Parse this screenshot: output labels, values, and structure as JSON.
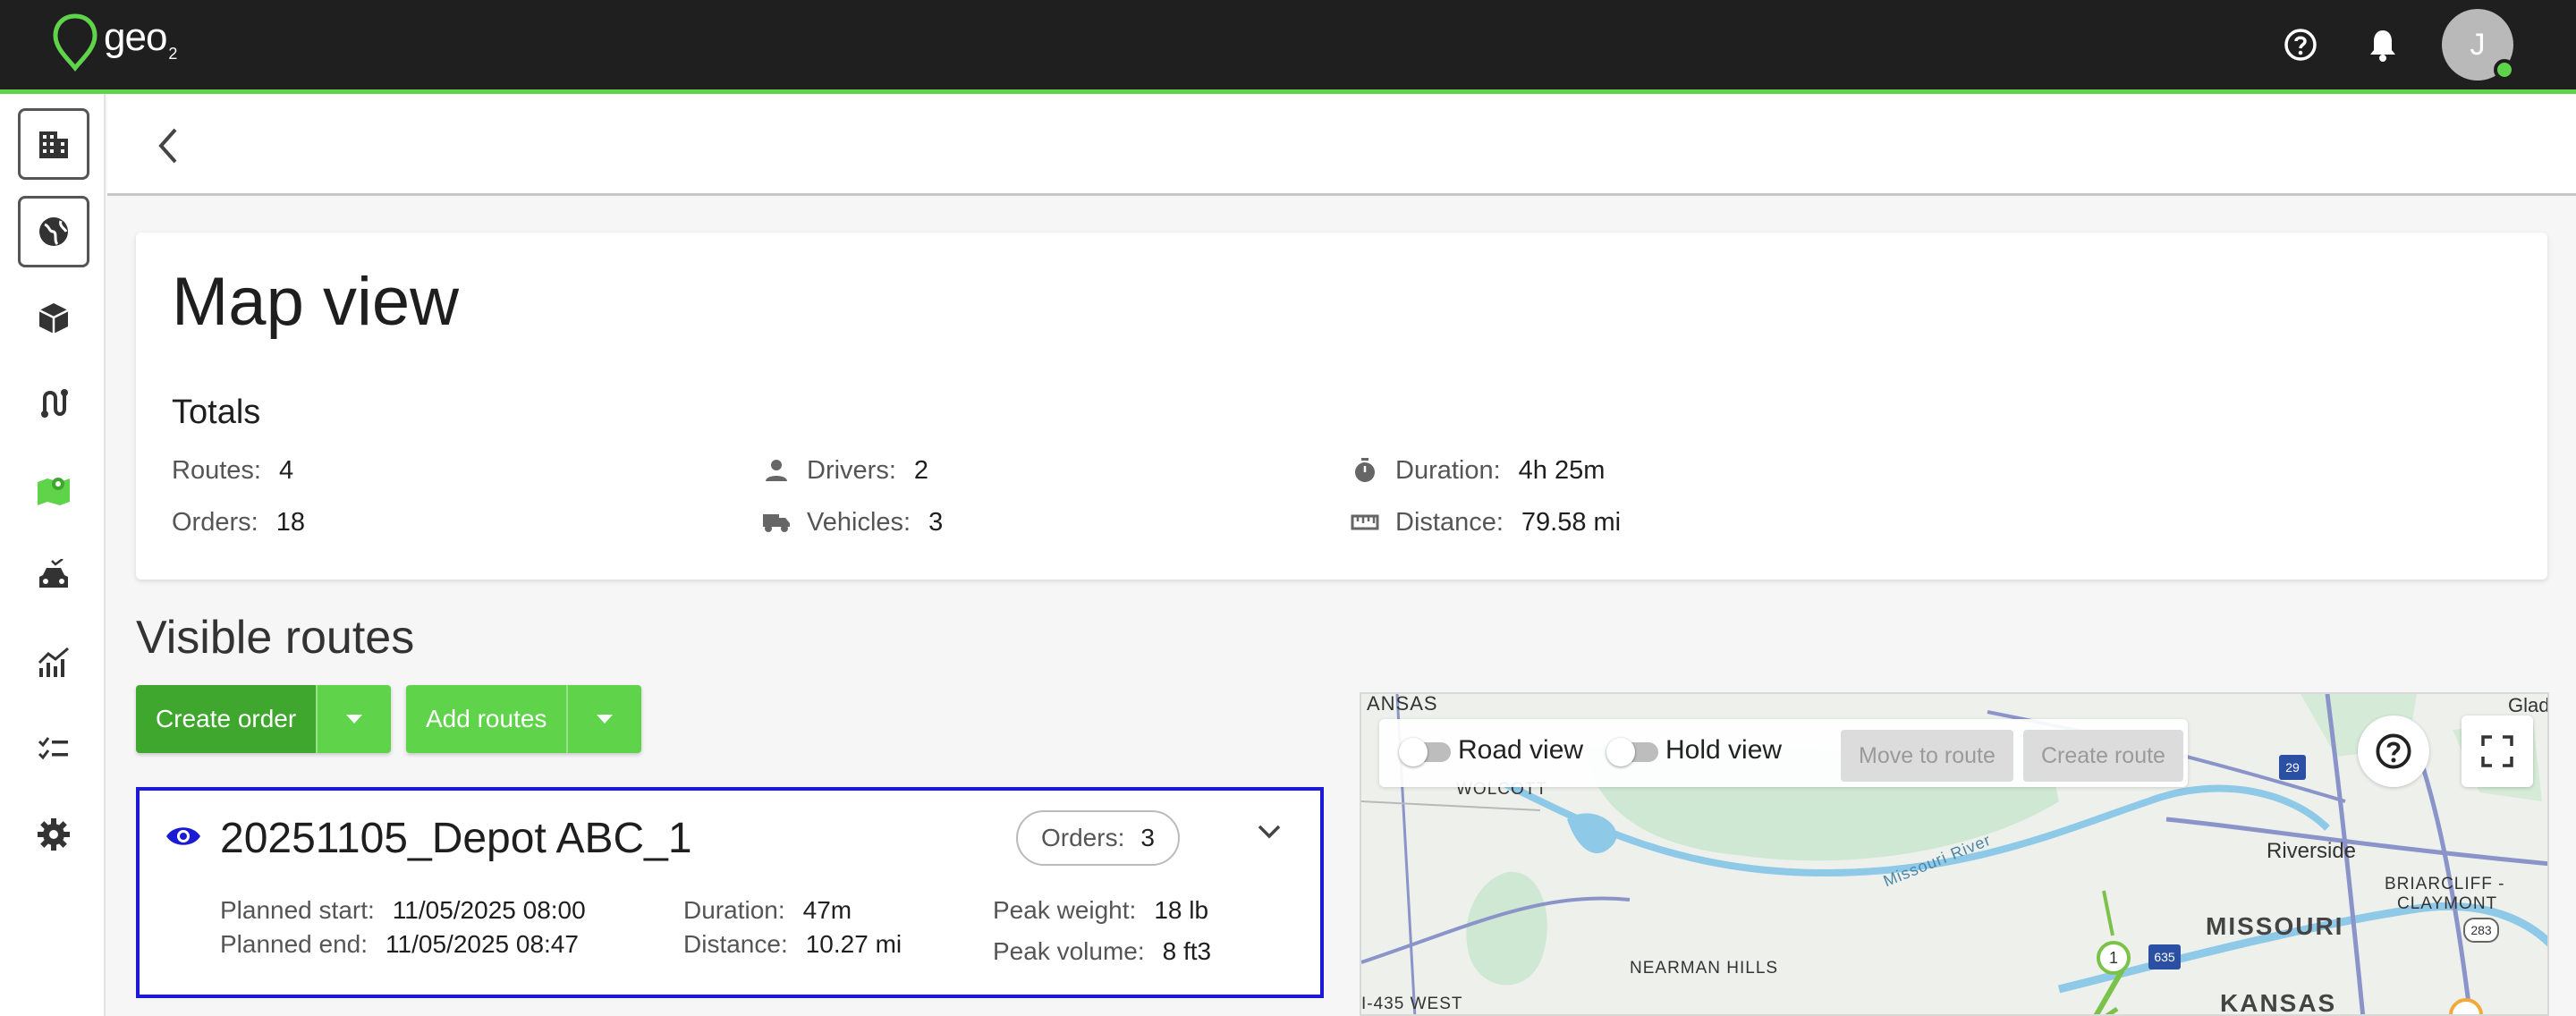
{
  "app": {
    "logo_text": "geo",
    "logo_sub": "2",
    "avatar_initial": "J"
  },
  "colors": {
    "brand_green": "#5fd34a",
    "dark_green": "#3fa72e",
    "route_border": "#1b1bd6",
    "topbar": "#1f1f1f"
  },
  "topbar": {
    "icons": [
      "help-icon",
      "bell-icon"
    ]
  },
  "sidebar": {
    "items": [
      {
        "icon": "building-icon"
      },
      {
        "icon": "globe-icon"
      },
      {
        "icon": "boxes-icon"
      },
      {
        "icon": "route-icon"
      },
      {
        "icon": "map-icon",
        "active": true
      },
      {
        "icon": "car-icon"
      },
      {
        "icon": "chart-icon"
      },
      {
        "icon": "checklist-icon"
      },
      {
        "icon": "gear-icon"
      }
    ]
  },
  "page": {
    "title": "Map view",
    "totals_heading": "Totals",
    "totals": {
      "routes_label": "Routes:",
      "routes": "4",
      "orders_label": "Orders:",
      "orders": "18",
      "drivers_label": "Drivers:",
      "drivers": "2",
      "vehicles_label": "Vehicles:",
      "vehicles": "3",
      "duration_label": "Duration:",
      "duration": "4h 25m",
      "distance_label": "Distance:",
      "distance": "79.58 mi"
    },
    "visible_routes_title": "Visible routes",
    "create_order_label": "Create order",
    "add_routes_label": "Add routes"
  },
  "route": {
    "name": "20251105_Depot ABC_1",
    "orders_label": "Orders:",
    "orders": "3",
    "planned_start_label": "Planned start:",
    "planned_start": "11/05/2025 08:00",
    "planned_end_label": "Planned end:",
    "planned_end": "11/05/2025 08:47",
    "duration_label": "Duration:",
    "duration": "47m",
    "distance_label": "Distance:",
    "distance": "10.27 mi",
    "peak_weight_label": "Peak weight:",
    "peak_weight": "18 lb",
    "peak_volume_label": "Peak volume:",
    "peak_volume": "8 ft3"
  },
  "map": {
    "road_view_label": "Road view",
    "hold_view_label": "Hold view",
    "move_to_route_label": "Move to route",
    "create_route_label": "Create route",
    "labels": {
      "kansas_top": "ANSAS",
      "wolcott": "WOLCOTT",
      "missouri_river": "Missouri River",
      "riverside": "Riverside",
      "briarcliff": "BRIARCLIFF -",
      "claymont": "CLAYMONT",
      "missouri": "MISSOURI",
      "nearman": "NEARMAN HILLS",
      "i435": "I-435 WEST",
      "kansas_bottom": "KANSAS",
      "glad": "Glad",
      "shield_29": "29",
      "shield_635": "635",
      "shield_283": "283",
      "stop_1": "1"
    }
  }
}
